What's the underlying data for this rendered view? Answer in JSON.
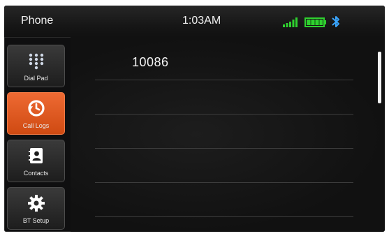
{
  "status_bar": {
    "app_title": "Phone",
    "time": "1:03AM",
    "signal_icon": "signal-icon",
    "battery_icon": "battery-icon",
    "bluetooth_icon": "bluetooth-icon",
    "accent_color": "#2fd12f"
  },
  "sidebar": {
    "items": [
      {
        "label": "Dial Pad",
        "icon": "dialpad-icon",
        "active": false
      },
      {
        "label": "Call Logs",
        "icon": "history-icon",
        "active": true
      },
      {
        "label": "Contacts",
        "icon": "contacts-icon",
        "active": false
      },
      {
        "label": "BT Setup",
        "icon": "gear-icon",
        "active": false
      }
    ],
    "active_color": "#e35b22"
  },
  "call_log": {
    "entries": [
      "10086"
    ]
  }
}
